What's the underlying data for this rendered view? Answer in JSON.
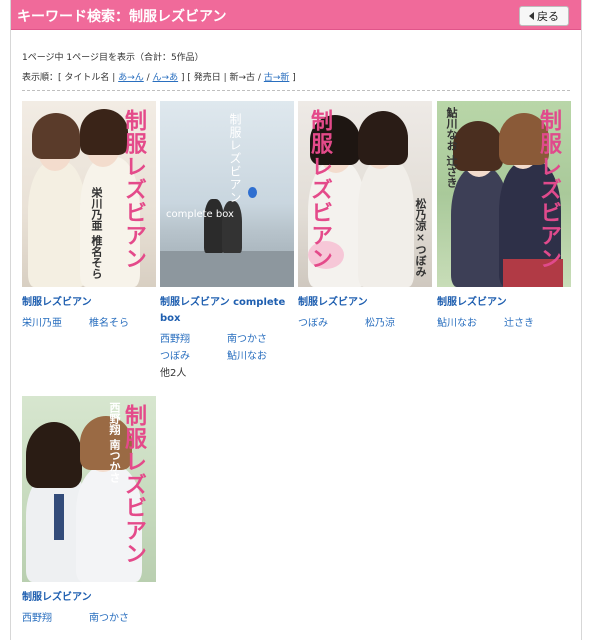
{
  "header": {
    "title": "キーワード検索：制服レズビアン",
    "back_label": "戻る"
  },
  "page_info": "1ページ中 1ページ目を表示（合計：5作品）",
  "sort": {
    "prefix": "表示順：[",
    "title_label": "タイトル名",
    "asc": "あ→ん",
    "slash1": "/",
    "desc": "ん→あ",
    "mid": "] [ 発売日 |",
    "newold": "新→古",
    "slash2": "/",
    "oldnew": "古→新",
    "suffix": "]"
  },
  "items": [
    {
      "title": "制服レズビアン",
      "cover_title": "制服レズビアン",
      "cover_names": "栄川乃亜 椎名そら",
      "actors": [
        "栄川乃亜",
        "椎名そら"
      ]
    },
    {
      "title": "制服レズビアン complete box",
      "cover_title": "制服レズビアン",
      "cover_sub": "complete box",
      "actors": [
        "西野翔",
        "南つかさ",
        "つぼみ",
        "鮎川なお"
      ],
      "more": "他2人"
    },
    {
      "title": "制服レズビアン",
      "cover_title": "制服レズビアン",
      "cover_names": "松乃涼×つぼみ",
      "actors": [
        "つぼみ",
        "松乃涼"
      ]
    },
    {
      "title": "制服レズビアン",
      "cover_title": "制服レズビアン",
      "cover_names": "鮎川なお 辻さき",
      "actors": [
        "鮎川なお",
        "辻さき"
      ]
    },
    {
      "title": "制服レズビアン",
      "cover_title": "制服レズビアン",
      "cover_names": "西野翔 南つかさ",
      "actors": [
        "西野翔",
        "南つかさ"
      ]
    }
  ]
}
